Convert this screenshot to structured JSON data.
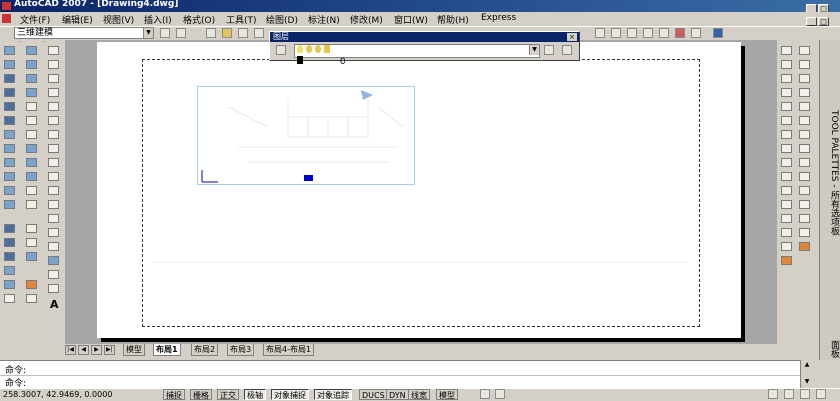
{
  "window": {
    "title": "AutoCAD 2007 - [Drawing4.dwg]",
    "controls": [
      "_",
      "□",
      "×"
    ],
    "doc_controls": [
      "_",
      "□",
      "×"
    ]
  },
  "menu": [
    {
      "label": "文件(F)"
    },
    {
      "label": "编辑(E)"
    },
    {
      "label": "视图(V)"
    },
    {
      "label": "插入(I)"
    },
    {
      "label": "格式(O)"
    },
    {
      "label": "工具(T)"
    },
    {
      "label": "绘图(D)"
    },
    {
      "label": "标注(N)"
    },
    {
      "label": "修改(M)"
    },
    {
      "label": "窗口(W)"
    },
    {
      "label": "帮助(H)"
    },
    {
      "label": "Express"
    }
  ],
  "workspace": {
    "selected": "三维建模"
  },
  "layer_toolbar": {
    "title": "图层",
    "current_layer": "0",
    "close": "×"
  },
  "tool_palettes": {
    "label": "TOOL PALETTES - 所有选项板",
    "panel_label": "面板"
  },
  "tabs": {
    "nav": [
      "|◀",
      "◀",
      "▶",
      "▶|"
    ],
    "items": [
      {
        "label": "模型",
        "active": false
      },
      {
        "label": "布局1",
        "active": true
      },
      {
        "label": "布局2",
        "active": false
      },
      {
        "label": "布局3",
        "active": false
      },
      {
        "label": "布局4-布局1",
        "active": false
      }
    ]
  },
  "command": {
    "line1": "命令:",
    "line2": "命令:"
  },
  "status": {
    "coords": "258.3007, 42.9469, 0.0000",
    "buttons": [
      {
        "label": "捕捉",
        "on": false
      },
      {
        "label": "栅格",
        "on": false
      },
      {
        "label": "正交",
        "on": false
      },
      {
        "label": "极轴",
        "on": true
      },
      {
        "label": "对象捕捉",
        "on": true
      },
      {
        "label": "对象追踪",
        "on": true
      },
      {
        "label": "DUCS",
        "on": false
      },
      {
        "label": "DYN",
        "on": false
      },
      {
        "label": "线宽",
        "on": false
      },
      {
        "label": "模型",
        "on": false
      }
    ]
  },
  "colors": {
    "title_bar": "#0a246a",
    "viewport_border": "#a8d0e8",
    "ucs_icon": "#0000cc"
  }
}
